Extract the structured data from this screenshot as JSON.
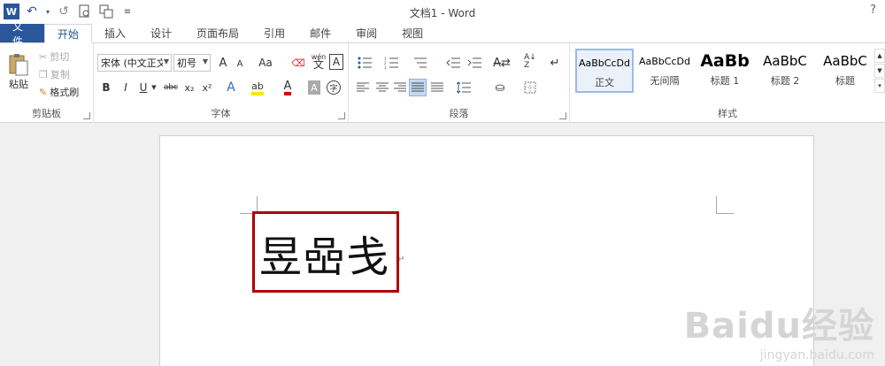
{
  "window": {
    "title": "文档1 - Word",
    "help": "?"
  },
  "qat": {
    "app_icon": "W",
    "undo": "↶",
    "redo": "↺"
  },
  "tabs": [
    {
      "label": "文件"
    },
    {
      "label": "开始"
    },
    {
      "label": "插入"
    },
    {
      "label": "设计"
    },
    {
      "label": "页面布局"
    },
    {
      "label": "引用"
    },
    {
      "label": "邮件"
    },
    {
      "label": "审阅"
    },
    {
      "label": "视图"
    }
  ],
  "clipboard": {
    "paste_label": "粘贴",
    "cut_label": "剪切",
    "copy_label": "复制",
    "format_painter_label": "格式刷",
    "group_label": "剪贴板"
  },
  "font": {
    "font_name": "宋体 (中文正文",
    "font_size": "初号",
    "grow": "A",
    "shrink": "A",
    "case": "Aa",
    "phonetic": "wén",
    "bold": "B",
    "italic": "I",
    "underline": "U",
    "strike": "abc",
    "subscript": "x₂",
    "superscript": "x²",
    "group_label": "字体"
  },
  "paragraph": {
    "group_label": "段落"
  },
  "styles": {
    "items": [
      {
        "preview": "AaBbCcDd",
        "name": "正文"
      },
      {
        "preview": "AaBbCcDd",
        "name": "无间隔"
      },
      {
        "preview": "AaBb",
        "name": "标题 1"
      },
      {
        "preview": "AaBbC",
        "name": "标题 2"
      },
      {
        "preview": "AaBbC",
        "name": "标题"
      }
    ],
    "group_label": "样式"
  },
  "document": {
    "text": "昱喦戋"
  },
  "watermark": {
    "line1": "Baidu经验",
    "line2": "jingyan.baidu.com"
  },
  "colors": {
    "accent": "#2b579a",
    "highlight_border": "#b00000"
  }
}
